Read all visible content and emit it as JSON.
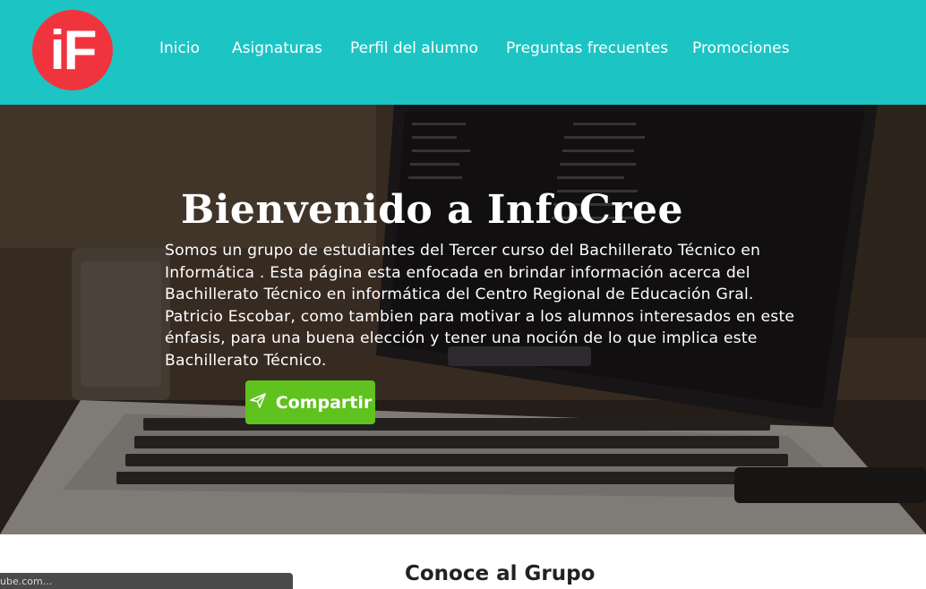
{
  "header": {
    "logo_text": "iF",
    "nav": [
      {
        "label": "Inicio"
      },
      {
        "label": "Asignaturas"
      },
      {
        "label": "Perfil del alumno"
      },
      {
        "label": "Preguntas frecuentes"
      },
      {
        "label": "Promociones"
      }
    ]
  },
  "hero": {
    "title": "Bienvenido a InfoCree",
    "description": "Somos un grupo de estudiantes del Tercer curso del Bachillerato Técnico en Informática . Esta página esta enfocada en brindar información acerca del Bachillerato Técnico en informática del Centro Regional de Educación Gral. Patricio Escobar, como tambien para motivar a los alumnos interesados en este énfasis, para una buena elección y tener una noción de lo que implica este Bachillerato Técnico.",
    "share_button": {
      "label": "Compartir",
      "icon": "send-icon"
    }
  },
  "video": {
    "url_text": "ube.com..."
  },
  "section": {
    "title": "Conoce al Grupo"
  },
  "colors": {
    "header_bg": "#1cc4c4",
    "logo_bg": "#f0343e",
    "button_bg": "#5fc21e"
  }
}
